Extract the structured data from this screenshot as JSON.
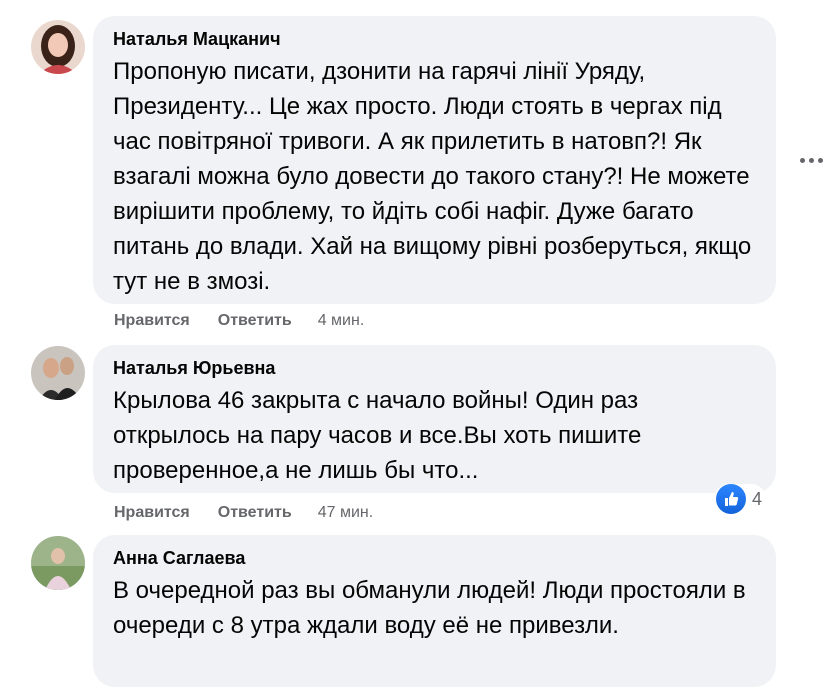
{
  "comments": [
    {
      "author": "Наталья Мацканич",
      "text": "Пропоную писати, дзонити на гарячі лінії Уряду, Президенту... Це жах просто. Люди стоять в чергах під час повітряної тривоги. А як прилетить в натовп?! Як взагалі можна було довести до такого стану?! Не можете вирішити проблему, то йдіть собі нафіг. Дуже багато питань до влади. Хай на вищому рівні розберуться, якщо тут не в змозі.",
      "like_label": "Нравится",
      "reply_label": "Ответить",
      "time": "4 мин."
    },
    {
      "author": "Наталья Юрьевна",
      "text": "Крылова 46 закрыта с начало войны! Один раз открылось на пару часов и все.Вы хоть пишите проверенное,а не лишь бы что...",
      "like_label": "Нравится",
      "reply_label": "Ответить",
      "time": "47 мин.",
      "reaction_icon": "like-icon",
      "reaction_count": "4"
    },
    {
      "author": "Анна Саглаева",
      "text": "В очередной раз вы обманули людей! Люди простояли в очереди с 8 утра ждали воду её не привезли."
    }
  ],
  "colors": {
    "bubble": "#f0f2f5",
    "meta": "#65676b",
    "like_blue": "#1877f2"
  }
}
